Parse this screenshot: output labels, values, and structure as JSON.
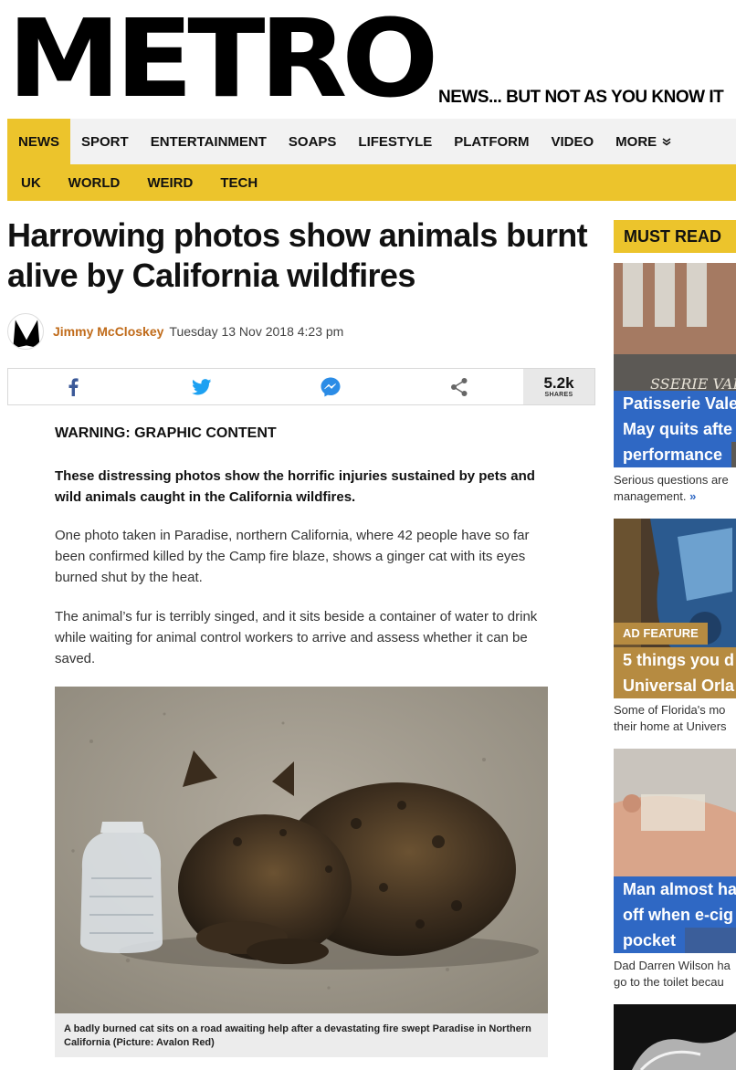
{
  "brand": {
    "logo_text": "METRO",
    "tagline": "NEWS... BUT NOT AS YOU KNOW IT"
  },
  "nav": {
    "primary": [
      {
        "label": "NEWS",
        "active": true
      },
      {
        "label": "SPORT",
        "active": false
      },
      {
        "label": "ENTERTAINMENT",
        "active": false
      },
      {
        "label": "SOAPS",
        "active": false
      },
      {
        "label": "LIFESTYLE",
        "active": false
      },
      {
        "label": "PLATFORM",
        "active": false
      },
      {
        "label": "VIDEO",
        "active": false
      },
      {
        "label": "MORE",
        "active": false
      }
    ],
    "more_icon": "chevron-down-icon",
    "secondary": [
      "UK",
      "WORLD",
      "WEIRD",
      "TECH"
    ]
  },
  "article": {
    "headline": "Harrowing photos show animals burnt alive by California wildfires",
    "author": "Jimmy McCloskey",
    "date": "Tuesday 13 Nov 2018 4:23 pm",
    "share": {
      "icons": [
        "facebook-icon",
        "twitter-icon",
        "messenger-icon",
        "share-icon"
      ],
      "count": "5.2k",
      "count_label": "SHARES"
    },
    "warning": "WARNING: GRAPHIC CONTENT",
    "intro": "These distressing photos show the horrific injuries sustained by pets and wild animals caught in the California wildfires.",
    "paragraphs": [
      "One photo taken in Paradise, northern California, where 42 people have so far been confirmed killed by the Camp fire blaze, shows a ginger cat with its eyes burned shut by the heat.",
      "The animal’s fur is terribly singed, and it sits beside a container of water to drink while waiting for animal control workers to arrive and assess whether it can be saved."
    ],
    "photo_caption": "A badly burned cat sits on a road awaiting help after a devastating fire swept Paradise in Northern California (Picture: Avalon Red)"
  },
  "sidebar": {
    "heading": "MUST READ",
    "cards": [
      {
        "title_lines": [
          "Patisserie Vale",
          "May quits afte",
          "performance"
        ],
        "desc_lines": [
          "Serious questions are",
          "management."
        ],
        "more": "»"
      },
      {
        "tag": "AD FEATURE",
        "title_lines": [
          "5 things you d",
          "Universal Orla"
        ],
        "desc_lines": [
          "Some of Florida's mo",
          "their home at Univers"
        ]
      },
      {
        "title_lines": [
          "Man almost ha",
          "off when e-cig",
          "pocket"
        ],
        "desc_lines": [
          "Dad Darren Wilson ha",
          "go to the toilet becau"
        ]
      }
    ]
  },
  "colors": {
    "accent_yellow": "#ecc42c",
    "author_orange": "#c06b1a",
    "card_blue": "#2f68c4",
    "ad_tan": "#b68b41"
  }
}
